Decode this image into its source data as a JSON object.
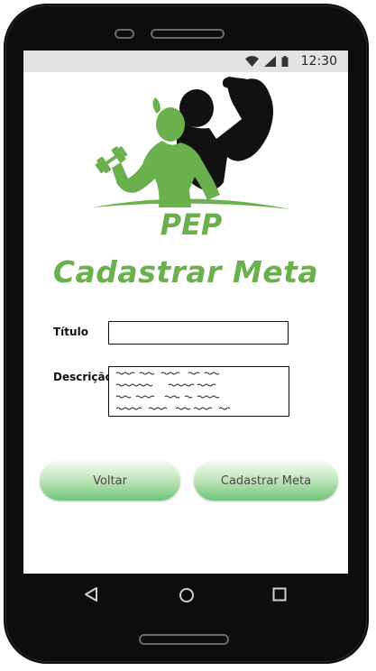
{
  "status_bar": {
    "time": "12:30",
    "icons": [
      "wifi-icon",
      "signal-icon",
      "battery-icon"
    ]
  },
  "logo": {
    "brand_text": "PEP",
    "accent_color": "#6ab04c",
    "dark_color": "#111111"
  },
  "page": {
    "title": "Cadastrar Meta"
  },
  "form": {
    "titulo_label": "Título",
    "titulo_value": "",
    "descricao_label": "Descrição"
  },
  "buttons": {
    "back_label": "Voltar",
    "submit_label": "Cadastrar Meta"
  },
  "navigation": {
    "icons": [
      "back-triangle-icon",
      "home-circle-icon",
      "recents-square-icon"
    ]
  },
  "colors": {
    "accent": "#6ab04c",
    "button_gradient_top": "#f4fbf2",
    "button_gradient_bottom": "#6fc57a",
    "status_bar_bg": "#e3e3e3",
    "phone_body": "#0d0d0d"
  }
}
